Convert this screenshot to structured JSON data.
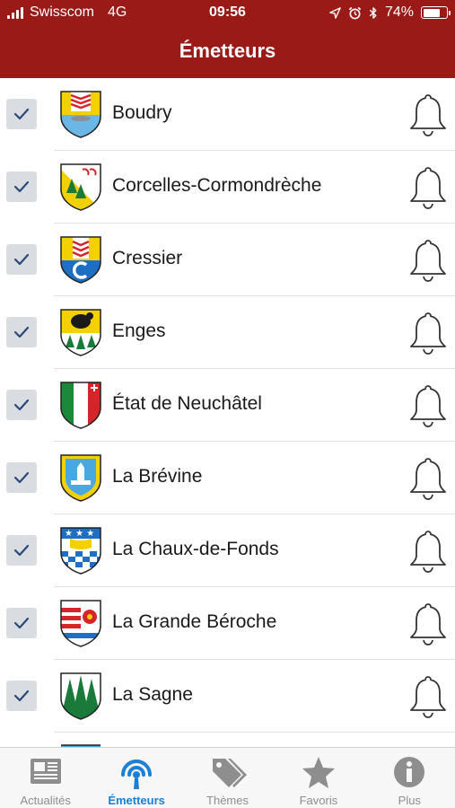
{
  "status_bar": {
    "carrier": "Swisscom",
    "network": "4G",
    "time": "09:56",
    "battery_percent_label": "74%",
    "battery_level": 0.74,
    "icons": [
      "signal-icon",
      "location-icon",
      "alarm-icon",
      "bluetooth-icon",
      "battery-icon"
    ]
  },
  "header": {
    "title": "Émetteurs"
  },
  "list": {
    "items": [
      {
        "name": "Boudry",
        "checked": true,
        "crest": "boudry-crest"
      },
      {
        "name": "Corcelles-Cormondrèche",
        "checked": true,
        "crest": "corcelles-crest"
      },
      {
        "name": "Cressier",
        "checked": true,
        "crest": "cressier-crest"
      },
      {
        "name": "Enges",
        "checked": true,
        "crest": "enges-crest"
      },
      {
        "name": "État de Neuchâtel",
        "checked": true,
        "crest": "neuchatel-crest"
      },
      {
        "name": "La Brévine",
        "checked": true,
        "crest": "la-brevine-crest"
      },
      {
        "name": "La Chaux-de-Fonds",
        "checked": true,
        "crest": "la-chaux-de-fonds-crest"
      },
      {
        "name": "La Grande Béroche",
        "checked": true,
        "crest": "la-grande-beroche-crest"
      },
      {
        "name": "La Sagne",
        "checked": true,
        "crest": "la-sagne-crest"
      }
    ]
  },
  "tabbar": {
    "tabs": [
      {
        "label": "Actualités",
        "icon": "newspaper-icon",
        "active": false
      },
      {
        "label": "Émetteurs",
        "icon": "broadcast-icon",
        "active": true
      },
      {
        "label": "Thèmes",
        "icon": "tags-icon",
        "active": false
      },
      {
        "label": "Favoris",
        "icon": "star-icon",
        "active": false
      },
      {
        "label": "Plus",
        "icon": "info-icon",
        "active": false
      }
    ]
  },
  "colors": {
    "header_background": "#9a1a17",
    "active_tab": "#1c7fd6",
    "inactive_tab": "#8e8e8e",
    "checkbox_background": "#d9dce1",
    "checkmark": "#2b4a78"
  }
}
